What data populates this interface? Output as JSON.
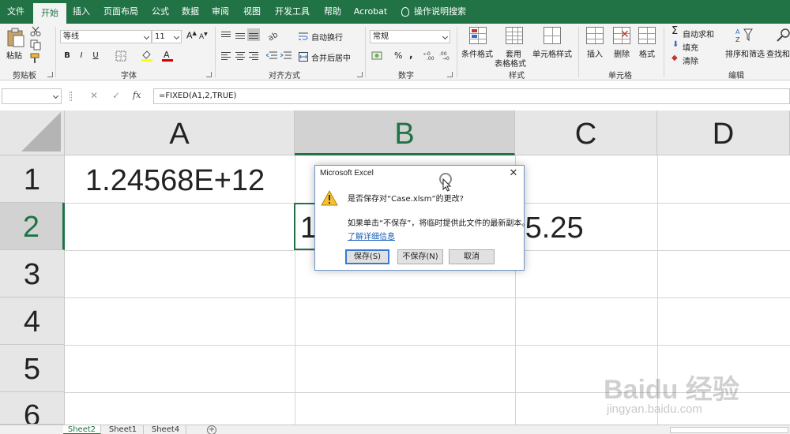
{
  "menu": {
    "tabs": [
      {
        "label": "文件"
      },
      {
        "label": "开始"
      },
      {
        "label": "插入"
      },
      {
        "label": "页面布局"
      },
      {
        "label": "公式"
      },
      {
        "label": "数据"
      },
      {
        "label": "审阅"
      },
      {
        "label": "视图"
      },
      {
        "label": "开发工具"
      },
      {
        "label": "帮助"
      },
      {
        "label": "Acrobat"
      }
    ],
    "active_tab": "开始",
    "tell_me": "操作说明搜索"
  },
  "ribbon": {
    "clipboard": {
      "paste": "粘贴",
      "group": "剪贴板"
    },
    "font": {
      "name": "等线",
      "size": "11",
      "group": "字体",
      "bold": "B",
      "italic": "I",
      "underline": "U"
    },
    "alignment": {
      "wrap": "自动换行",
      "merge": "合并后居中",
      "group": "对齐方式"
    },
    "number": {
      "format": "常规",
      "percent": "%",
      "comma": ",",
      "group": "数字"
    },
    "styles": {
      "conditional": "条件格式",
      "table_line1": "套用",
      "table_line2": "表格格式",
      "cell_styles": "单元格样式",
      "group": "样式"
    },
    "cells": {
      "insert": "插入",
      "delete": "删除",
      "format": "格式",
      "group": "单元格"
    },
    "editing": {
      "autosum": "自动求和",
      "fill": "填充",
      "clear": "清除",
      "sort": "排序和筛选",
      "find": "查找和",
      "group": "编辑"
    }
  },
  "formula_bar": {
    "formula": "=FIXED(A1,2,TRUE)",
    "fx": "fx"
  },
  "columns": [
    "A",
    "B",
    "C",
    "D"
  ],
  "rows": [
    "1",
    "2",
    "3",
    "4",
    "5",
    "6"
  ],
  "cells": {
    "A1": "1.24568E+12",
    "B2_visible": "1",
    "C2_visible": "-5.25"
  },
  "sheets": [
    "Sheet2",
    "Sheet1",
    "Sheet4"
  ],
  "dialog": {
    "title": "Microsoft Excel",
    "message": "是否保存对“Case.xlsm”的更改?",
    "info": "如果单击“不保存”，将临时提供此文件的最新副本。",
    "link": "了解详细信息",
    "buttons": {
      "save": "保存(S)",
      "dont_save": "不保存(N)",
      "cancel": "取消"
    }
  },
  "watermark": {
    "brand": "Baidu 经验",
    "url": "jingyan.baidu.com"
  },
  "colors": {
    "excel_green": "#217346",
    "ribbon_bg": "#f3f3f3",
    "link": "#1a5fb4"
  }
}
